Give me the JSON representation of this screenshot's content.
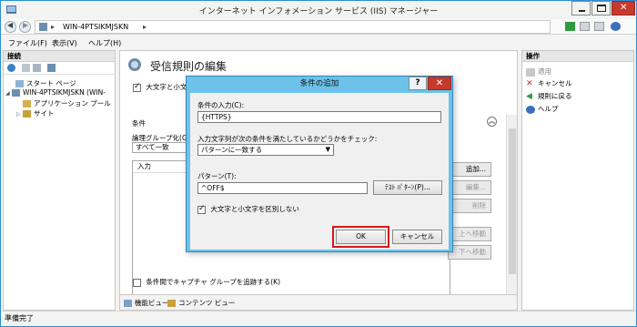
{
  "window": {
    "title": "インターネット インフォメーション サービス (IIS) マネージャー",
    "accent": "#2a8fd6"
  },
  "address": {
    "path": "WIN-4PTSIKMJSKN",
    "separator": "▸"
  },
  "menu": [
    "ファイル(F)",
    "表示(V)",
    "ヘルプ(H)"
  ],
  "connections": {
    "header": "接続",
    "tree": [
      {
        "label": "スタート ページ",
        "icon": "start-page-icon"
      },
      {
        "label": "WIN-4PTSIKMJSKN (WIN-",
        "icon": "server-icon"
      },
      {
        "label": "アプリケーション プール",
        "icon": "app-pool-icon"
      },
      {
        "label": "サイト",
        "icon": "sites-icon"
      }
    ]
  },
  "center": {
    "title": "受信規則の編集",
    "ignore_case_label": "大文字と小文",
    "conditions_header": "条件",
    "logical_grouping_label": "論理グループ化(G)",
    "logical_grouping_value": "すべて一致",
    "grid_column": "入力",
    "side_buttons": [
      "追加...",
      "編集...",
      "削除",
      "上へ移動",
      "下へ移動"
    ],
    "track_groups_label": "条件間でキャプチャ グループを追跡する(K)"
  },
  "bottom_tabs": [
    "機能ビュー",
    "コンテンツ ビュー"
  ],
  "actions": {
    "header": "操作",
    "items": [
      {
        "label": "適用",
        "icon": "apply-icon",
        "enabled": false
      },
      {
        "label": "キャンセル",
        "icon": "cancel-icon",
        "enabled": true
      },
      {
        "label": "規則に戻る",
        "icon": "back-arrow-icon",
        "enabled": true
      },
      {
        "label": "ヘルプ",
        "icon": "help-icon",
        "enabled": true
      }
    ]
  },
  "status": "準備完了",
  "dialog": {
    "title": "条件の追加",
    "help_label": "?",
    "close_label": "✕",
    "condition_input_label": "条件の入力(C):",
    "condition_input_value": "{HTTPS}",
    "check_label": "入力文字列が次の条件を満たしているかどうかをチェック:",
    "check_value": "パターンに一致する",
    "pattern_label": "パターン(T):",
    "pattern_value": "^OFF$",
    "test_pattern_button": "ﾃｽﾄ ﾊﾟﾀｰﾝ(P)...",
    "ignore_case_label": "大文字と小文字を区別しない",
    "ok_button": "OK",
    "cancel_button": "キャンセル",
    "highlight_color": "#d11a1a"
  }
}
